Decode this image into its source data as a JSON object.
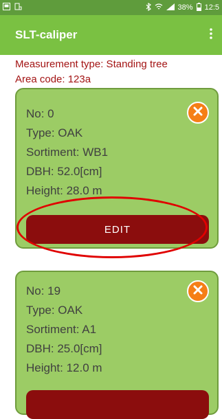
{
  "status_bar": {
    "left_icons": [
      "gallery-icon",
      "notification-icon"
    ],
    "right_icons": [
      "bluetooth-icon",
      "wifi-icon",
      "signal-icon"
    ],
    "battery": "38%",
    "time": "12:5"
  },
  "app_bar": {
    "title": "SLT-caliper",
    "menu_icon": "more-vert-icon"
  },
  "info": {
    "measurement_type": "Measurement type: Standing tree",
    "area_code": "Area code: 123a"
  },
  "cards": [
    {
      "no": "No: 0",
      "type": "Type: OAK",
      "sortiment": "Sortiment: WB1",
      "dbh": "DBH: 52.0[cm]",
      "height": "Height: 28.0 m",
      "edit_label": "EDIT"
    },
    {
      "no": "No: 19",
      "type": "Type: OAK",
      "sortiment": "Sortiment: A1",
      "dbh": "DBH: 25.0[cm]",
      "height": "Height: 12.0 m",
      "edit_label": ""
    }
  ],
  "colors": {
    "app_bar": "#7ac142",
    "status_bar": "#5f9c3c",
    "info_text": "#a31414",
    "card_bg": "#9ccc65",
    "edit_button": "#8b0d0d",
    "delete_button": "#f57f17",
    "highlight": "#e00000"
  }
}
